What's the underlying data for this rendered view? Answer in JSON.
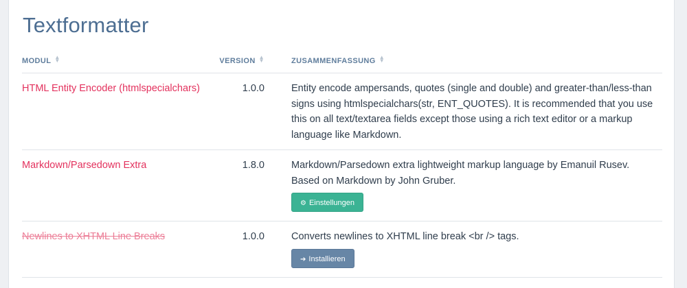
{
  "page": {
    "title": "Textformatter"
  },
  "table": {
    "headers": {
      "module": "MODUL",
      "version": "VERSION",
      "summary": "ZUSAMMENFASSUNG"
    },
    "rows": [
      {
        "module": "HTML Entity Encoder (htmlspecialchars)",
        "version": "1.0.0",
        "summary": "Entity encode ampersands, quotes (single and double) and greater-than/less-than signs using htmlspecialchars(str, ENT_QUOTES). It is recommended that you use this on all text/textarea fields except those using a rich text editor or a markup language like Markdown.",
        "installed": true
      },
      {
        "module": "Markdown/Parsedown Extra",
        "version": "1.8.0",
        "summary": "Markdown/Parsedown extra lightweight markup language by Emanuil Rusev. Based on Markdown by John Gruber.",
        "installed": true,
        "button": {
          "label": "Einstellungen",
          "icon": "gear-icon",
          "color": "#3bb394"
        }
      },
      {
        "module": "Newlines to XHTML Line Breaks",
        "version": "1.0.0",
        "summary": "Converts newlines to XHTML line break <br /> tags.",
        "installed": false,
        "button": {
          "label": "Installieren",
          "icon": "sign-in-icon",
          "color": "#6786a6"
        }
      }
    ]
  },
  "colors": {
    "title": "#4d6e92",
    "link": "#e3315d",
    "link_disabled": "#ec7f98",
    "header": "#5f7d9c"
  }
}
